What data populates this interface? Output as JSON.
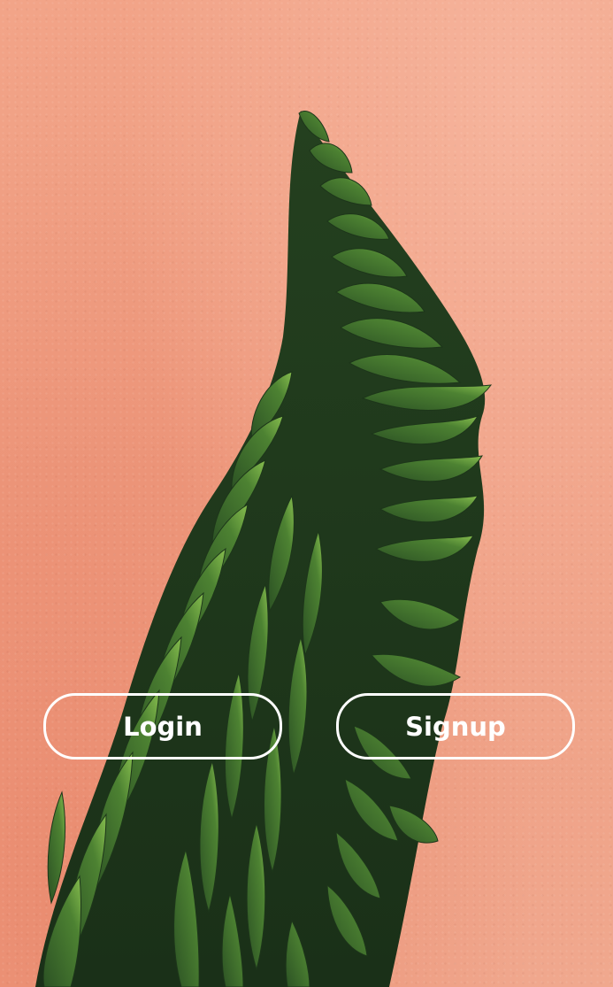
{
  "actions": {
    "login_label": "Login",
    "signup_label": "Signup"
  },
  "colors": {
    "background": "#f2a488",
    "button_border": "#ffffff",
    "button_text": "#ffffff",
    "plant_dark": "#1f3a1c",
    "plant_mid": "#3f6b2c",
    "plant_light": "#7fb44a"
  },
  "background_image": {
    "subject": "araucaria-plant-on-coral-wall"
  }
}
